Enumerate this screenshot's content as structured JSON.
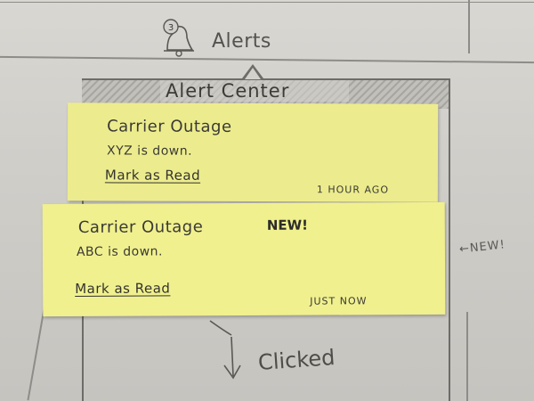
{
  "header": {
    "alert_count": "3",
    "title": "Alerts"
  },
  "alert_center": {
    "title": "Alert Center",
    "alerts": [
      {
        "title": "Carrier Outage",
        "message": "XYZ is down.",
        "action": "Mark as Read",
        "time": "1 HOUR AGO",
        "badge": ""
      },
      {
        "title": "Carrier Outage",
        "message": "ABC is down.",
        "action": "Mark as Read",
        "time": "JUST NOW",
        "badge": "NEW!"
      }
    ]
  },
  "annotations": {
    "new_marker": "←NEW!",
    "clicked": "Clicked"
  },
  "colors": {
    "sticky_note": "#ecec8e",
    "paper": "#d0cec9",
    "pencil": "#6e6c68"
  }
}
